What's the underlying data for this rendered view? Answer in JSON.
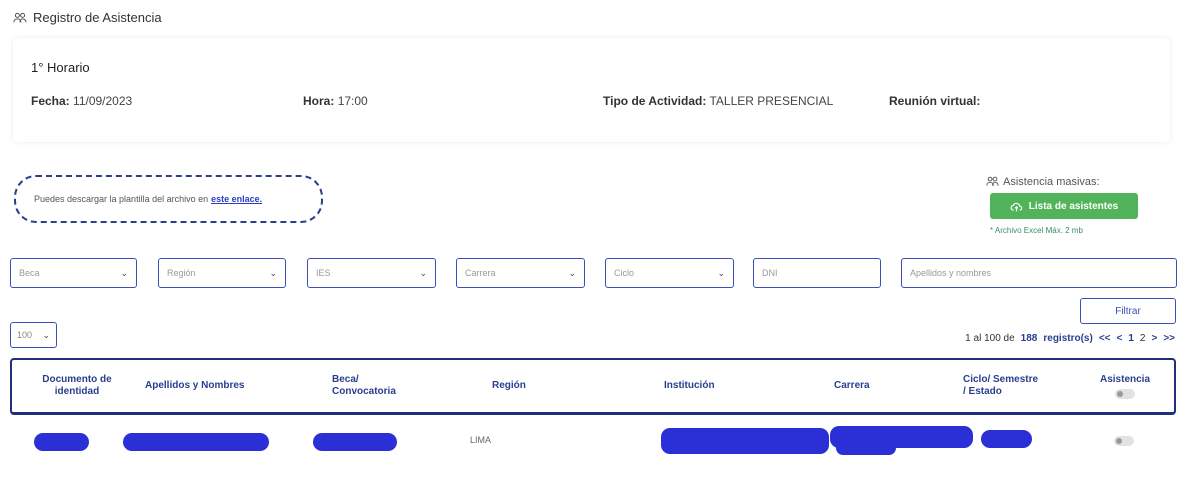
{
  "header": {
    "title": "Registro de Asistencia",
    "icon": "users-icon"
  },
  "info": {
    "horario": "1° Horario",
    "fecha_label": "Fecha:",
    "fecha_value": "11/09/2023",
    "hora_label": "Hora:",
    "hora_value": "17:00",
    "tipo_label": "Tipo de Actividad:",
    "tipo_value": "TALLER PRESENCIAL",
    "reunion_label": "Reunión virtual:"
  },
  "download": {
    "text": "Puedes descargar la plantilla del archivo en",
    "link": "este enlace."
  },
  "bulk": {
    "label": "Asistencia masivas:",
    "button": "Lista de asistentes",
    "hint": "* Archivo Excel Máx. 2 mb"
  },
  "filters": {
    "beca": "Beca",
    "region": "Región",
    "ies": "IES",
    "carrera": "Carrera",
    "ciclo": "Ciclo",
    "dni_placeholder": "DNI",
    "nombres_placeholder": "Apellidos y nombres",
    "filter_button": "Filtrar"
  },
  "pagesize": "100",
  "pager": {
    "range": "1 al 100 de",
    "total": "188",
    "suffix": "registro(s)",
    "first": "<<",
    "prev": "<",
    "page1": "1",
    "page2": "2",
    "next": ">",
    "last": ">>"
  },
  "columns": {
    "doc": "Documento de identidad",
    "nombres": "Apellidos y Nombres",
    "beca": "Beca/ Convocatoria",
    "region": "Región",
    "institucion": "Institución",
    "carrera": "Carrera",
    "ciclo": "Ciclo/ Semestre / Estado",
    "asistencia": "Asistencia"
  },
  "rows": [
    {
      "region": "LIMA"
    }
  ],
  "colors": {
    "primary": "#2a3e8f",
    "green": "#52b45a",
    "redaction": "#2a2fd6"
  }
}
